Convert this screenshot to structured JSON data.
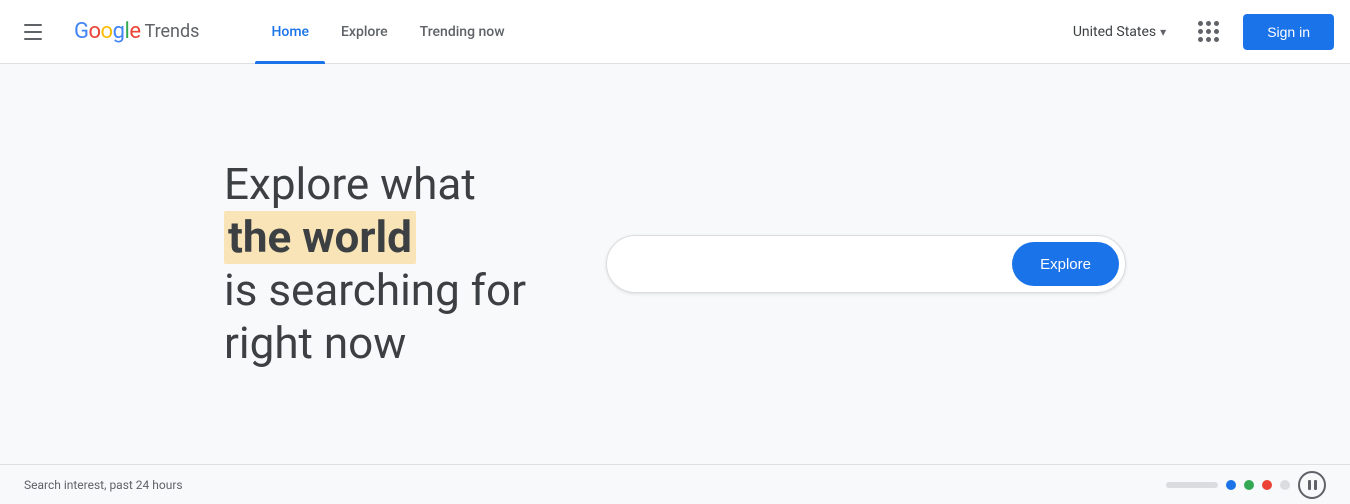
{
  "navbar": {
    "hamburger_label": "Menu",
    "logo": {
      "google": "Google",
      "trends": "Trends"
    },
    "nav_items": [
      {
        "label": "Home",
        "active": true
      },
      {
        "label": "Explore",
        "active": false
      },
      {
        "label": "Trending now",
        "active": false
      }
    ],
    "country": "United States",
    "sign_in_label": "Sign in",
    "grid_label": "Google apps"
  },
  "hero": {
    "line1": "Explore what",
    "line2": "the world",
    "line3": "is searching for",
    "line4": "right now"
  },
  "search": {
    "placeholder": "",
    "explore_button_label": "Explore"
  },
  "footer": {
    "search_interest_label": "Search interest, past 24 hours"
  },
  "colors": {
    "accent_blue": "#1a73e8",
    "highlight_yellow": "#f9e4b7",
    "dot_blue": "#1a73e8",
    "dot_green": "#34a853",
    "dot_red": "#ea4335"
  }
}
